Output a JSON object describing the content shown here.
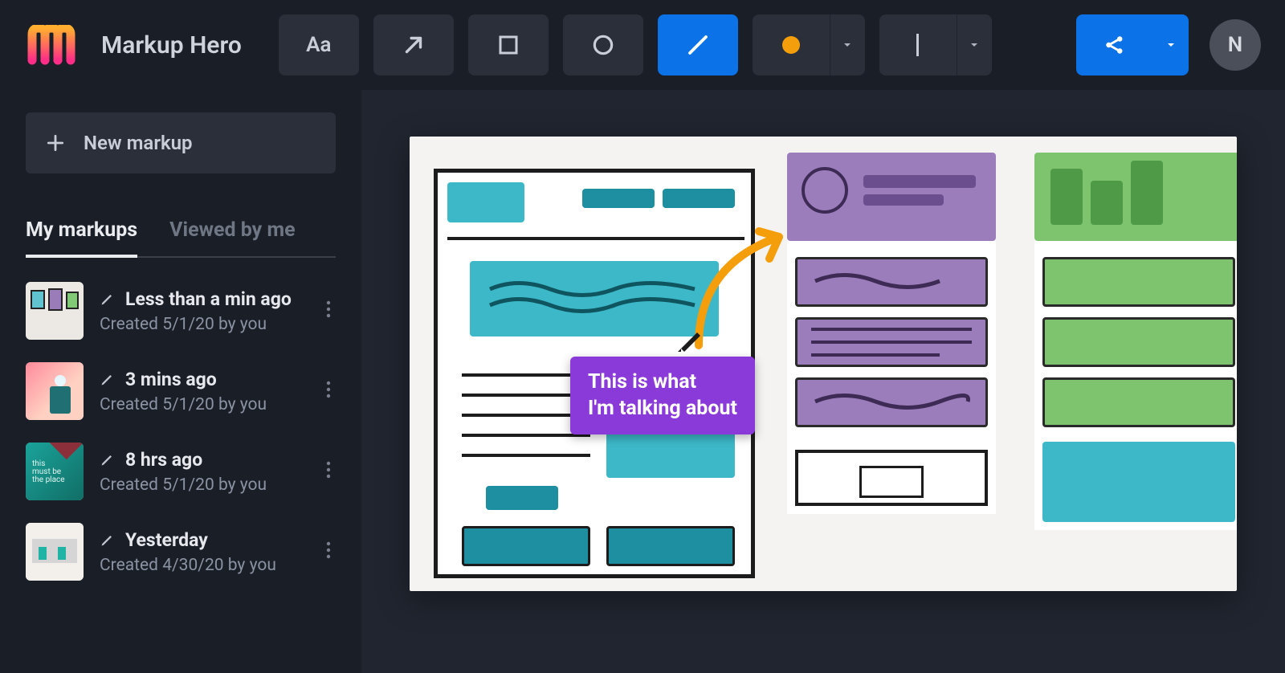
{
  "app": {
    "title": "Markup Hero",
    "avatar_initial": "N"
  },
  "toolbar": {
    "text_label": "Aa",
    "tools": {
      "text": "text-tool",
      "arrow": "arrow-tool",
      "rect": "rectangle-tool",
      "oval": "oval-tool",
      "pen": "pen-tool"
    },
    "active_tool": "pen",
    "color_swatch": "#f59e0b",
    "stroke_style": "thin",
    "share_label": "Share"
  },
  "sidebar": {
    "new_markup_label": "New markup",
    "tabs": {
      "my_markups": "My markups",
      "viewed_by_me": "Viewed by me",
      "active": "my_markups"
    },
    "items": [
      {
        "title": "Less than a min ago",
        "subtitle": "Created 5/1/20 by you"
      },
      {
        "title": "3 mins ago",
        "subtitle": "Created 5/1/20 by you"
      },
      {
        "title": "8 hrs ago",
        "subtitle": "Created 5/1/20 by you"
      },
      {
        "title": "Yesterday",
        "subtitle": "Created 4/30/20 by you"
      }
    ]
  },
  "canvas": {
    "annotation_text": "This is what\nI'm talking about",
    "annotation_bg": "#8a3ad8",
    "arrow_color": "#f59e0b"
  }
}
